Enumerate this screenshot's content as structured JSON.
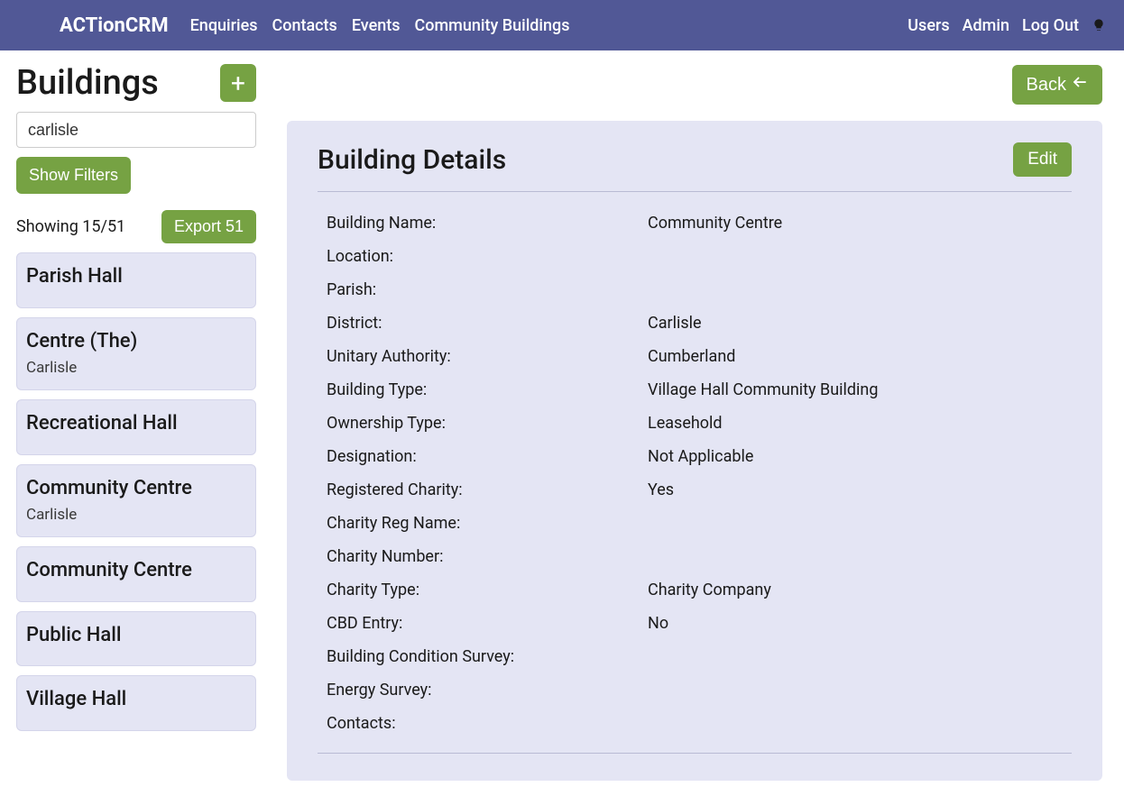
{
  "nav": {
    "brand": "ACTionCRM",
    "links": [
      "Enquiries",
      "Contacts",
      "Events",
      "Community Buildings"
    ],
    "right": [
      "Users",
      "Admin",
      "Log Out"
    ]
  },
  "sidebar": {
    "title": "Buildings",
    "search_value": "carlisle",
    "filters_label": "Show Filters",
    "showing_text": "Showing 15/51",
    "export_label": "Export 51",
    "items": [
      {
        "title": "Parish Hall",
        "sub": ""
      },
      {
        "title": "Centre (The)",
        "sub": "Carlisle"
      },
      {
        "title": "Recreational Hall",
        "sub": ""
      },
      {
        "title": "Community Centre",
        "sub": "Carlisle"
      },
      {
        "title": "Community Centre",
        "sub": ""
      },
      {
        "title": "Public Hall",
        "sub": ""
      },
      {
        "title": "Village Hall",
        "sub": ""
      }
    ]
  },
  "main": {
    "back_label": "Back",
    "details_title": "Building Details",
    "edit_label": "Edit",
    "fields": [
      {
        "label": "Building Name:",
        "value": "Community Centre"
      },
      {
        "label": "Location:",
        "value": ""
      },
      {
        "label": "Parish:",
        "value": ""
      },
      {
        "label": "District:",
        "value": "Carlisle"
      },
      {
        "label": "Unitary Authority:",
        "value": "Cumberland"
      },
      {
        "label": "Building Type:",
        "value": "Village Hall Community Building"
      },
      {
        "label": "Ownership Type:",
        "value": "Leasehold"
      },
      {
        "label": "Designation:",
        "value": "Not Applicable"
      },
      {
        "label": "Registered Charity:",
        "value": "Yes"
      },
      {
        "label": "Charity Reg Name:",
        "value": ""
      },
      {
        "label": "Charity Number:",
        "value": ""
      },
      {
        "label": "Charity Type:",
        "value": "Charity Company"
      },
      {
        "label": "CBD Entry:",
        "value": "No"
      },
      {
        "label": "Building Condition Survey:",
        "value": ""
      },
      {
        "label": "Energy Survey:",
        "value": ""
      },
      {
        "label": "Contacts:",
        "value": ""
      }
    ]
  }
}
